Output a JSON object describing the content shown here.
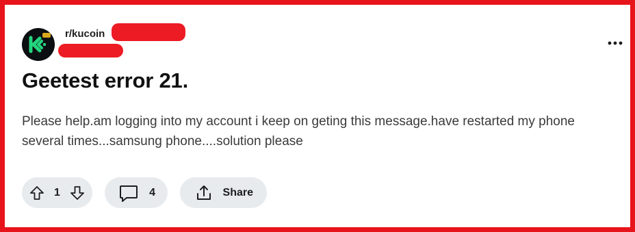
{
  "post": {
    "subreddit": "r/kucoin",
    "title": "Geetest error 21.",
    "body": "Please help.am logging into my account i keep on geting this message.have restarted my phone several times...samsung phone....solution please"
  },
  "actions": {
    "vote_count": "1",
    "comment_count": "4",
    "share_label": "Share"
  },
  "icons": {
    "avatar": "kucoin-logo",
    "more": "more-options-icon",
    "upvote": "upvote-arrow-icon",
    "downvote": "downvote-arrow-icon",
    "comment": "comment-bubble-icon",
    "share": "share-icon"
  },
  "colors": {
    "frame": "#e8141c",
    "redaction": "#ec1b24",
    "pill_bg": "#e7ebee",
    "brand_green": "#24d67e"
  }
}
